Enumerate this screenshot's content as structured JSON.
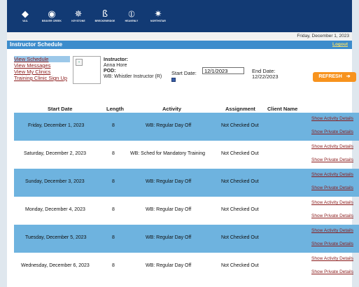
{
  "brands": [
    {
      "name": "VAIL",
      "icon": "vail-logo-icon"
    },
    {
      "name": "BEAVER CREEK",
      "icon": "beaver-creek-logo-icon"
    },
    {
      "name": "KEYSTONE",
      "icon": "keystone-logo-icon"
    },
    {
      "name": "BRECKENRIDGE",
      "icon": "breckenridge-logo-icon"
    },
    {
      "name": "HEAVENLY",
      "icon": "heavenly-logo-icon"
    },
    {
      "name": "NORTHSTAR",
      "icon": "northstar-logo-icon"
    }
  ],
  "date_bar": "Friday, December 1, 2023",
  "title": "Instructor Schedule",
  "logout": "Logout",
  "nav": [
    "View Schedule",
    "View Messages",
    "View My Clinics",
    "Training Clinic Sign Up"
  ],
  "instructor": {
    "label": "Instructor:",
    "name": "Anna Hore",
    "pod_label": "POD:",
    "pod": "WB: Whistler Instructor (R)"
  },
  "start_date": {
    "label": "Start Date:",
    "value": "12/1/2023"
  },
  "end_date": {
    "label": "End Date:",
    "value": "12/22/2023"
  },
  "refresh": "REFRESH",
  "columns": [
    "Start Date",
    "Length",
    "Activity",
    "Assignment",
    "Client Name"
  ],
  "row_links": [
    "Show Activity Details",
    "Show Private Details"
  ],
  "rows": [
    {
      "date": "Friday, December 1, 2023",
      "length": "8",
      "activity": "WB: Regular Day Off",
      "assignment": "Not Checked Out"
    },
    {
      "date": "Saturday, December 2, 2023",
      "length": "8",
      "activity": "WB: Sched for Mandatory Training",
      "assignment": "Not Checked Out"
    },
    {
      "date": "Sunday, December 3, 2023",
      "length": "8",
      "activity": "WB: Regular Day Off",
      "assignment": "Not Checked Out"
    },
    {
      "date": "Monday, December 4, 2023",
      "length": "8",
      "activity": "WB: Regular Day Off",
      "assignment": "Not Checked Out"
    },
    {
      "date": "Tuesday, December 5, 2023",
      "length": "8",
      "activity": "WB: Regular Day Off",
      "assignment": "Not Checked Out"
    },
    {
      "date": "Wednesday, December 6, 2023",
      "length": "8",
      "activity": "WB: Regular Day Off",
      "assignment": "Not Checked Out"
    }
  ],
  "colors": {
    "header": "#123a74",
    "title_bar": "#3c8ccc",
    "row_alt": "#6eb3df",
    "link": "#8a1a1a",
    "refresh": "#f7931e"
  }
}
